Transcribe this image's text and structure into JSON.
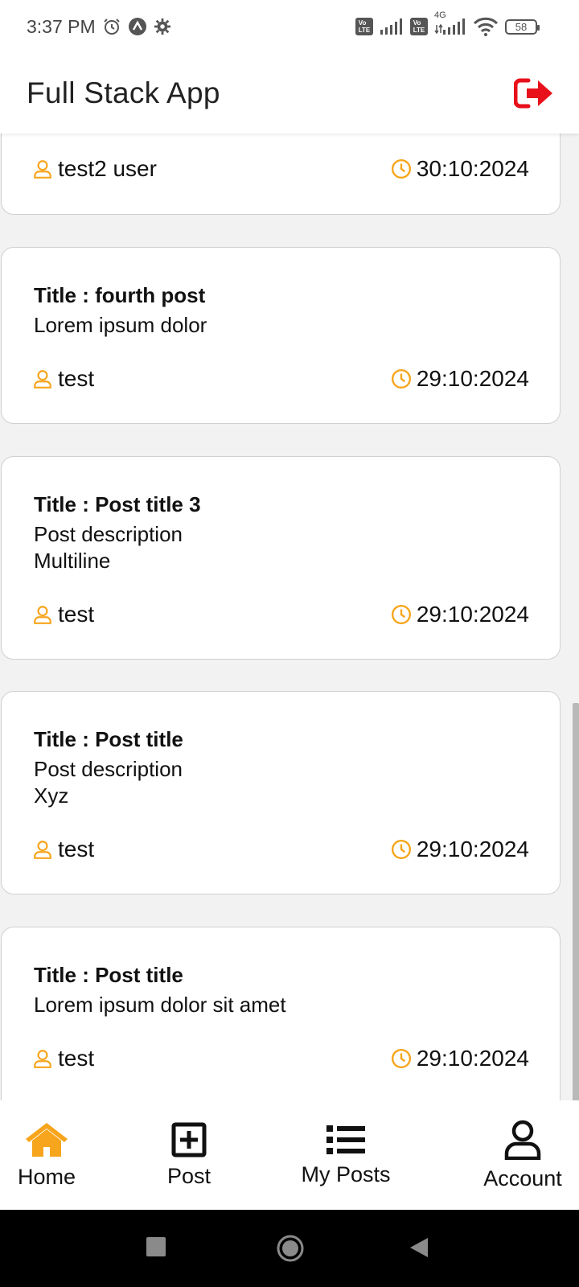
{
  "status_bar": {
    "time": "3:37 PM",
    "battery": "58",
    "network": "4G",
    "volte": "Vo LTE",
    "icons": [
      "alarm-icon",
      "app-logo-icon",
      "settings-gear-icon",
      "volte-icon",
      "signal-icon",
      "wifi-icon",
      "battery-icon"
    ]
  },
  "header": {
    "title": "Full Stack App",
    "logout_icon": "logout-icon"
  },
  "posts": [
    {
      "title": "",
      "description": "",
      "author": "test2 user",
      "date": "30:10:2024"
    },
    {
      "title": "Title : fourth post",
      "description": "Lorem ipsum dolor",
      "author": "test",
      "date": "29:10:2024"
    },
    {
      "title": "Title : Post title 3",
      "description": "Post description\nMultiline",
      "author": "test",
      "date": "29:10:2024"
    },
    {
      "title": "Title : Post title",
      "description": "Post description\nXyz",
      "author": "test",
      "date": "29:10:2024"
    },
    {
      "title": "Title : Post title",
      "description": "Lorem ipsum dolor sit amet",
      "author": "test",
      "date": "29:10:2024"
    }
  ],
  "bottom_nav": {
    "home": "Home",
    "post": "Post",
    "my_posts": "My Posts",
    "account": "Account",
    "active": "Home"
  },
  "colors": {
    "accent": "#F7A51C",
    "logout": "#E8101A",
    "header_bg": "#FFFFFF",
    "page_bg": "#F2F2F2"
  }
}
